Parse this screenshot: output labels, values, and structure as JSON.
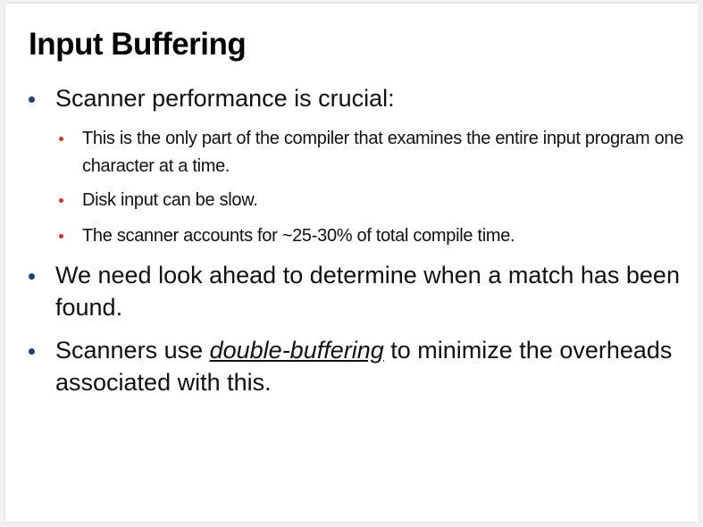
{
  "slide": {
    "title": "Input Buffering",
    "bullets": [
      {
        "text": "Scanner performance is crucial:",
        "sub": [
          "This is the only part of the compiler that examines the entire input program one character at a time.",
          "Disk input can be slow.",
          "The scanner accounts for ~25-30% of total compile time."
        ]
      },
      {
        "text": "We need look ahead to determine when a match has been found."
      },
      {
        "before": "Scanners use ",
        "emphasis": "double-buffering",
        "after": " to minimize the overheads associated with this."
      }
    ]
  },
  "colors": {
    "main_bullet": "#1f3f7a",
    "sub_bullet": "#c0392b",
    "text": "#111111"
  }
}
